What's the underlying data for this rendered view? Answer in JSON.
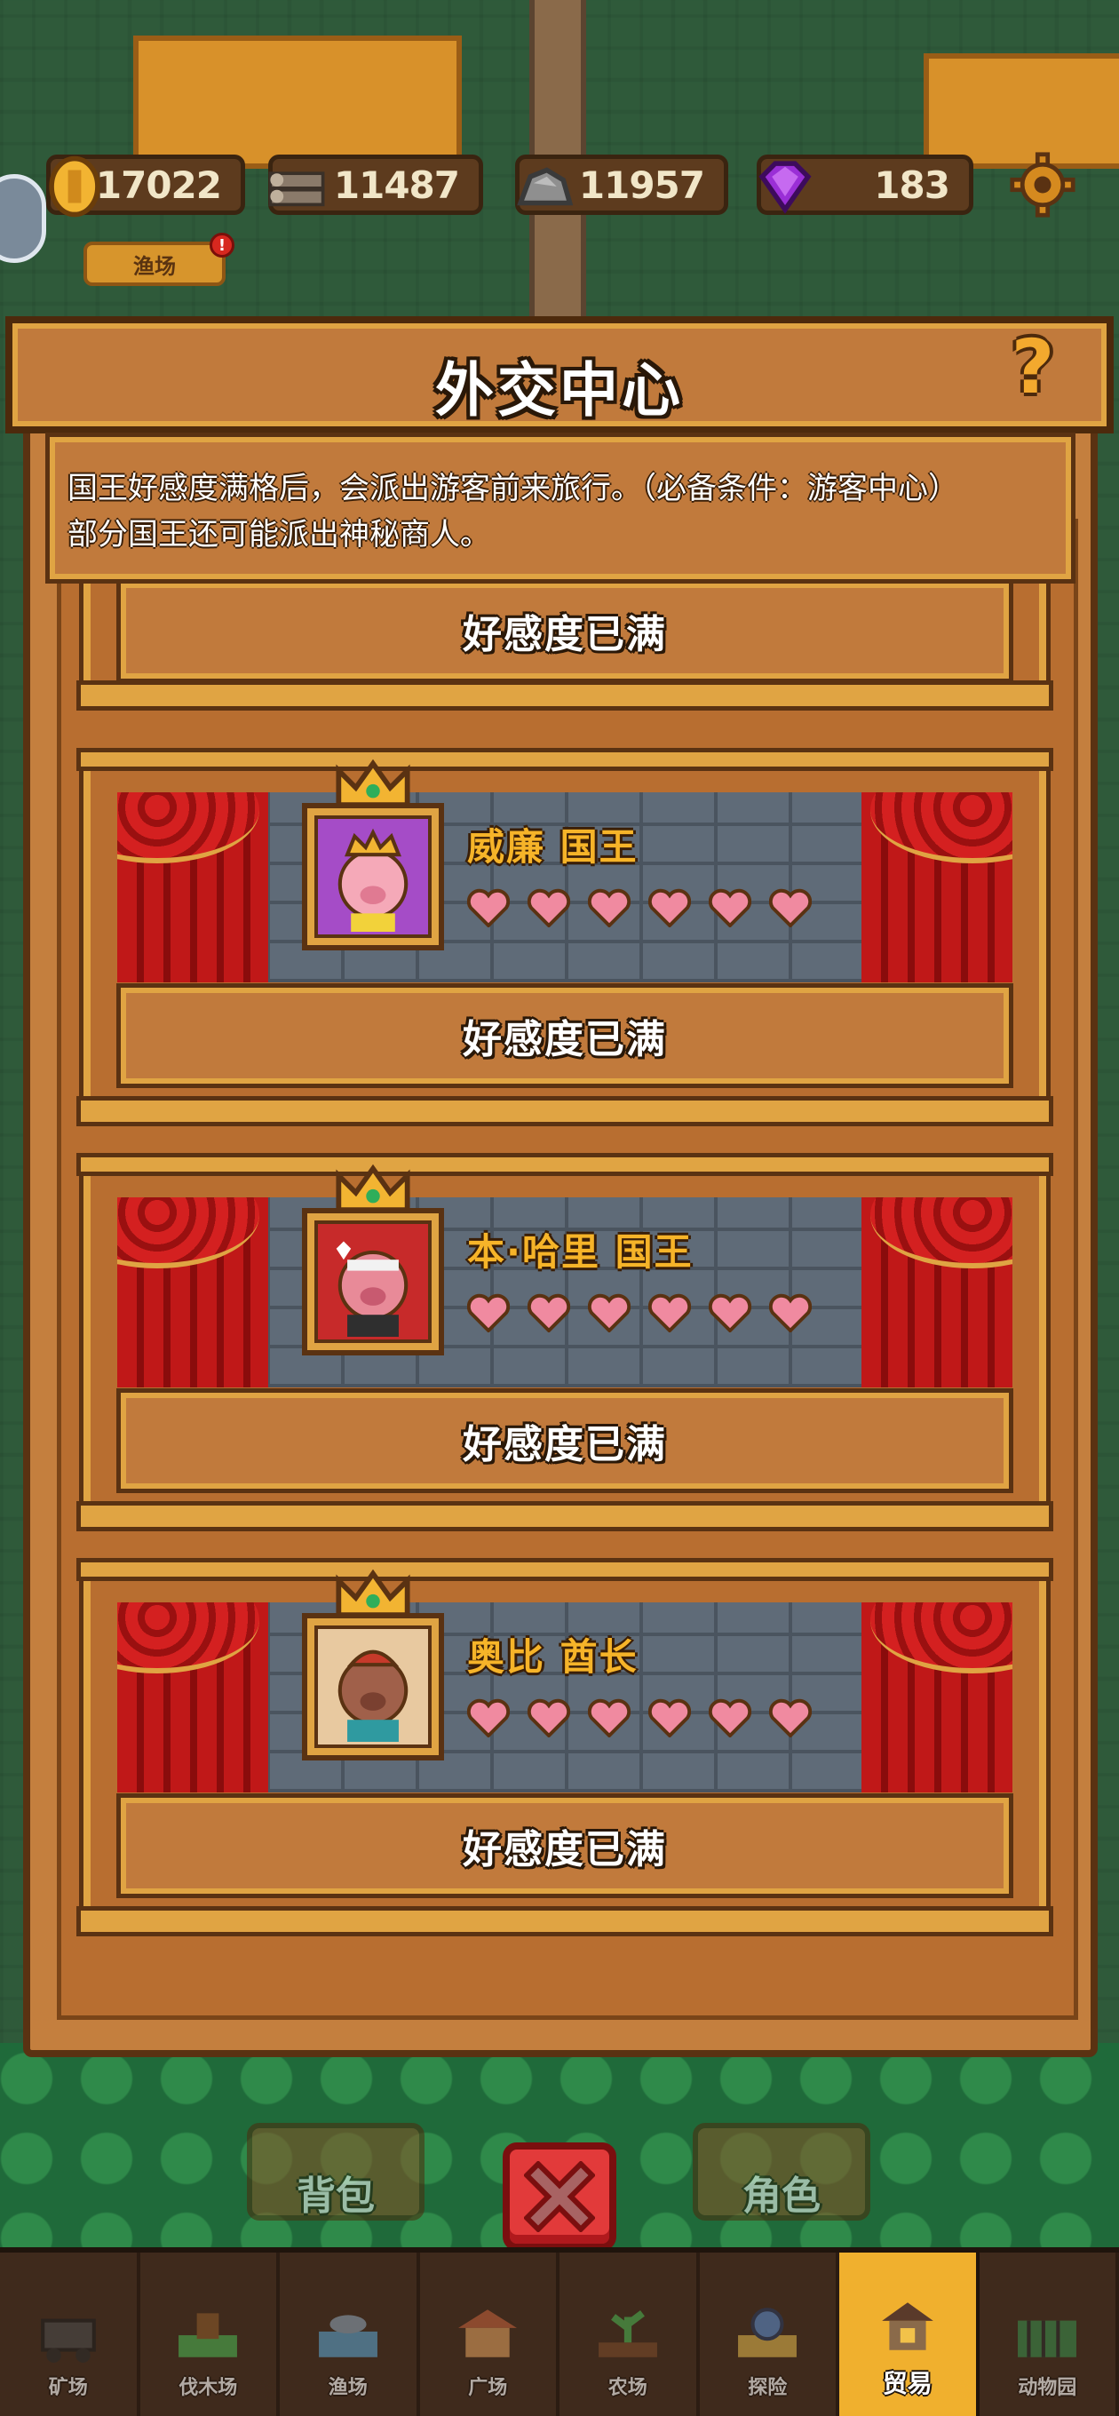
{
  "currencies": [
    {
      "icon": "gold-coin-icon",
      "value": "17022"
    },
    {
      "icon": "wood-logs-icon",
      "value": "11487"
    },
    {
      "icon": "stone-icon",
      "value": "11957"
    },
    {
      "icon": "purple-gem-icon",
      "value": "183"
    }
  ],
  "fishery_tag": "渔场",
  "fishery_badge": "!",
  "dialog": {
    "title": "外交中心",
    "help": "?",
    "description_line1": "国王好感度满格后，会派出游客前来旅行。（必备条件：游客中心）",
    "description_line2": "部分国王还可能派出神秘商人。"
  },
  "top_partial_card": {
    "status": "好感度已满"
  },
  "kings": [
    {
      "name": "威廉 国王",
      "hearts": 6,
      "hearts_filled": 6,
      "status": "好感度已满",
      "portrait_color": "#a54cc7"
    },
    {
      "name": "本·哈里 国王",
      "hearts": 6,
      "hearts_filled": 6,
      "status": "好感度已满",
      "portrait_color": "#c72a2a"
    },
    {
      "name": "奥比 酋长",
      "hearts": 6,
      "hearts_filled": 6,
      "status": "好感度已满",
      "portrait_color": "#e8c9a0"
    }
  ],
  "bottom_buttons": {
    "bag": "背包",
    "character": "角色"
  },
  "nav": [
    {
      "label": "矿场",
      "icon": "mine-cart-icon",
      "active": false
    },
    {
      "label": "伐木场",
      "icon": "lumber-icon",
      "active": false
    },
    {
      "label": "渔场",
      "icon": "fishery-icon",
      "active": false
    },
    {
      "label": "广场",
      "icon": "plaza-icon",
      "active": false
    },
    {
      "label": "农场",
      "icon": "farm-icon",
      "active": false
    },
    {
      "label": "探险",
      "icon": "explore-icon",
      "active": false
    },
    {
      "label": "贸易",
      "icon": "trade-icon",
      "active": true
    },
    {
      "label": "动物园",
      "icon": "zoo-icon",
      "active": false
    }
  ],
  "colors": {
    "gold": "#e0a443",
    "wood": "#c17a3c",
    "dark_brown": "#5a3212",
    "name_yellow": "#f6b429",
    "heart_pink": "#f08aa0",
    "close_red": "#e23a3a"
  }
}
